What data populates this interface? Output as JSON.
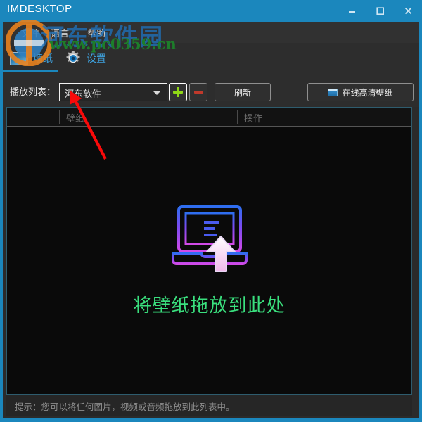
{
  "window": {
    "title": "IMDESKTOP",
    "controls": [
      {
        "name": "minimize",
        "glyph": "minimize-icon"
      },
      {
        "name": "maximize",
        "glyph": "maximize-icon"
      },
      {
        "name": "close",
        "glyph": "close-icon"
      }
    ],
    "accent_color": "#1b87bd"
  },
  "menubar": {
    "items": [
      {
        "label": "文件"
      },
      {
        "label": "语言"
      },
      {
        "label": "帮助"
      }
    ]
  },
  "tabs": {
    "active_index": 0,
    "items": [
      {
        "label": "墙纸",
        "icon": "monitor-icon"
      },
      {
        "label": "设置",
        "icon": "gear-icon"
      }
    ],
    "active_color": "#1b87bd"
  },
  "toolbar": {
    "playlist_label": "播放列表：",
    "playlist_value": "河东软件",
    "playlist_placeholder": "河东软件",
    "add_button": "+",
    "remove_button": "−",
    "refresh_button": "刷新",
    "online_button": "在线高清壁纸",
    "online_icon": "picture-icon"
  },
  "list": {
    "columns": [
      {
        "label": ""
      },
      {
        "label": "壁纸"
      },
      {
        "label": "操作"
      }
    ],
    "rows": [],
    "empty_state": {
      "text": "将壁纸拖放到此处",
      "text_color": "#3ae07e",
      "icon": "laptop-upload-icon",
      "icon_gradient_from": "#2e6ef0",
      "icon_gradient_to": "#d24ae8"
    }
  },
  "statusbar": {
    "text": "提示：您可以将任何图片，视频或音频拖放到此列表中。"
  },
  "watermark": {
    "site_name": "河东软件园",
    "url": "www.pc0359.cn",
    "site_color": "#1f6fb5",
    "url_color": "#1d7d2a"
  },
  "annotation": {
    "arrow_color": "#fa0a0a",
    "from": "150,226",
    "to": "103,140"
  }
}
